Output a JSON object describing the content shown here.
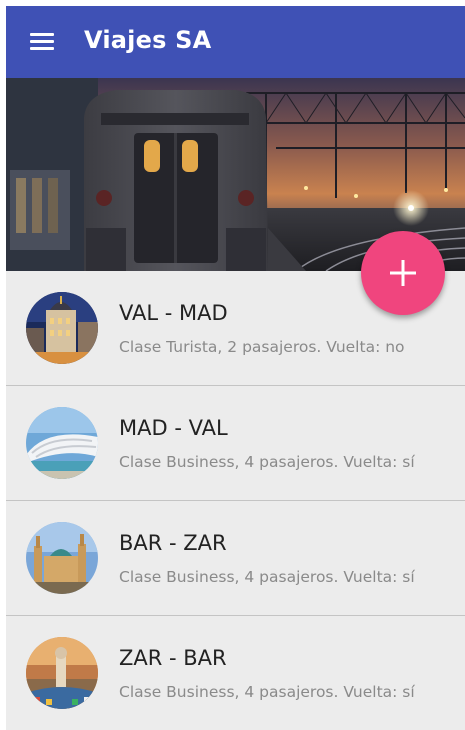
{
  "app": {
    "title": "Viajes SA",
    "primary_color": "#3f51b5",
    "accent_color": "#f0457e",
    "menu_icon": "hamburger-menu-icon",
    "fab_icon": "plus-icon"
  },
  "trips": [
    {
      "title": "VAL - MAD",
      "subtitle": "Clase Turista, 2 pasajeros. Vuelta: no"
    },
    {
      "title": "MAD - VAL",
      "subtitle": "Clase Business, 4 pasajeros. Vuelta: sí"
    },
    {
      "title": "BAR - ZAR",
      "subtitle": "Clase Business, 4 pasajeros. Vuelta: sí"
    },
    {
      "title": "ZAR - BAR",
      "subtitle": "Clase Business, 4 pasajeros. Vuelta: sí"
    }
  ]
}
